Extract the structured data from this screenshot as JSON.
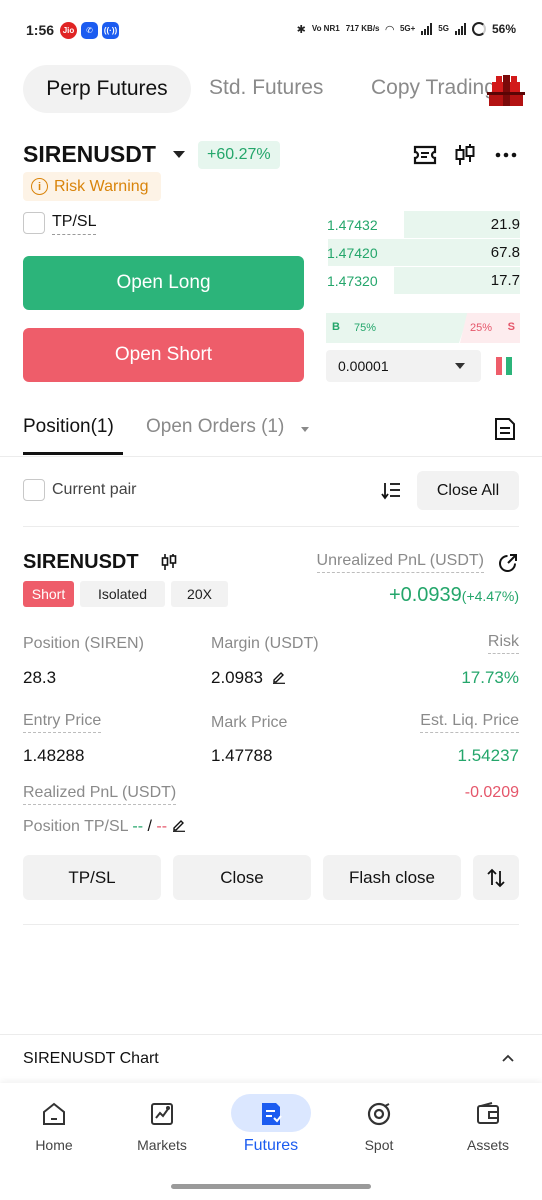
{
  "status_bar": {
    "time": "1:56",
    "network_label": "Vo NR1",
    "speed": "717 KB/s",
    "net_5g_1": "5G+",
    "net_5g_2": "5G",
    "battery": "56%"
  },
  "top_tabs": [
    "Perp Futures",
    "Std. Futures",
    "Copy Trading"
  ],
  "symbol": {
    "name": "SIRENUSDT",
    "change": "+60.27%",
    "risk_warning": "Risk Warning"
  },
  "order_form": {
    "tpsl_label": "TP/SL",
    "open_long": "Open Long",
    "open_short": "Open Short"
  },
  "order_book": {
    "rows": [
      {
        "price": "1.47432",
        "qty": "21.9",
        "depth": 0.6
      },
      {
        "price": "1.47420",
        "qty": "67.8",
        "depth": 0.99
      },
      {
        "price": "1.47320",
        "qty": "17.7",
        "depth": 0.65
      }
    ],
    "buy_label": "B",
    "buy_pct": "75%",
    "sell_pct": "25%",
    "sell_label": "S",
    "precision": "0.00001"
  },
  "positions_tabs": {
    "position": "Position(1)",
    "open_orders": "Open Orders (1)"
  },
  "filters": {
    "current_pair": "Current pair",
    "close_all": "Close All"
  },
  "position": {
    "symbol": "SIRENUSDT",
    "side": "Short",
    "margin_mode": "Isolated",
    "leverage": "20X",
    "unrealized_label": "Unrealized PnL (USDT)",
    "unrealized_value": "+0.0939",
    "unrealized_pct": "(+4.47%)",
    "size_label": "Position (SIREN)",
    "size_value": "28.3",
    "margin_label": "Margin (USDT)",
    "margin_value": "2.0983",
    "risk_label": "Risk",
    "risk_value": "17.73%",
    "entry_label": "Entry Price",
    "entry_value": "1.48288",
    "mark_label": "Mark Price",
    "mark_value": "1.47788",
    "liq_label": "Est. Liq. Price",
    "liq_value": "1.54237",
    "realized_label": "Realized PnL (USDT)",
    "realized_value": "-0.0209",
    "tpsl_label": "Position TP/SL",
    "tp_value": "--",
    "tpsl_sep": "/",
    "sl_value": "--"
  },
  "actions": {
    "tpsl": "TP/SL",
    "close": "Close",
    "flash_close": "Flash close"
  },
  "chart_section": {
    "title": "SIRENUSDT Chart"
  },
  "bottom_nav": {
    "items": [
      {
        "label": "Home",
        "icon": "home-icon"
      },
      {
        "label": "Markets",
        "icon": "markets-icon"
      },
      {
        "label": "Futures",
        "icon": "futures-icon"
      },
      {
        "label": "Spot",
        "icon": "spot-icon"
      },
      {
        "label": "Assets",
        "icon": "assets-icon"
      }
    ],
    "active": "Futures"
  },
  "colors": {
    "green": "#2cb47a",
    "red": "#ee5d6a",
    "accent_blue": "#1c5cf0",
    "warning": "#d9840b"
  }
}
